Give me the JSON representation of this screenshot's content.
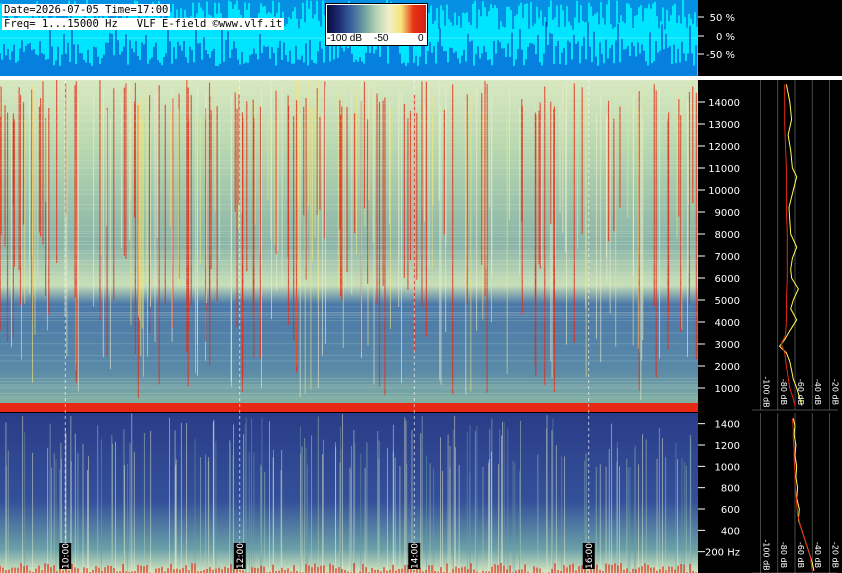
{
  "header": {
    "date_line": "Date=2026-07-05 Time=17:00",
    "freq_line": "Freq= 1...15000 Hz   VLF E-field ©www.vlf.it"
  },
  "colorbar": {
    "labels": [
      "-100 dB",
      "-50",
      "0"
    ],
    "stops": [
      "#0a0a3c",
      "#1e2d78",
      "#3c64a0",
      "#6ea0a0",
      "#b4d2b4",
      "#f0f0c8",
      "#f5e678",
      "#e63214",
      "#d21e14"
    ]
  },
  "colors": {
    "amplitude_bg": "#00e5ff",
    "amplitude_trace": "#0a3cc8",
    "yellow_profile": "#ffff50",
    "red_profile": "#e62814",
    "label": "#ffffff"
  },
  "chart_data": [
    {
      "type": "area",
      "panel": "amplitude",
      "y_ticks": [
        "50 %",
        "0 %",
        "-50 %"
      ],
      "ylim": [
        -100,
        100
      ]
    },
    {
      "type": "heatmap",
      "panel": "spectrogram-high",
      "xlabel": "",
      "ylabel": "",
      "ylim": [
        0,
        15000
      ],
      "y_ticks": [
        "14000",
        "13000",
        "12000",
        "11000",
        "10000",
        "9000",
        "8000",
        "7000",
        "6000",
        "5000",
        "4000",
        "3000",
        "2000",
        "1000"
      ],
      "xlim": [
        "09:00",
        "17:00"
      ],
      "time_marks": [
        "10:00",
        "12:00",
        "14:00",
        "16:00"
      ]
    },
    {
      "type": "heatmap",
      "panel": "spectrogram-low",
      "ylim": [
        0,
        1500
      ],
      "y_ticks": [
        "1400",
        "1200",
        "1000",
        "800",
        "600",
        "400",
        "200 Hz"
      ]
    },
    {
      "type": "line",
      "panel": "spectrum-high",
      "x_ticks": [
        "-100 dB",
        "-80 dB",
        "-60 dB",
        "-40 dB",
        "-20 dB"
      ],
      "xlim": [
        -110,
        -10
      ],
      "series": [
        {
          "color": "#ffff50",
          "points": [
            [
              -70,
              14800
            ],
            [
              -66,
              14000
            ],
            [
              -64,
              13200
            ],
            [
              -68,
              12500
            ],
            [
              -65,
              11800
            ],
            [
              -63,
              11000
            ],
            [
              -58,
              10600
            ],
            [
              -62,
              10000
            ],
            [
              -67,
              9200
            ],
            [
              -66,
              8600
            ],
            [
              -65,
              8000
            ],
            [
              -58,
              7400
            ],
            [
              -63,
              6900
            ],
            [
              -65,
              6400
            ],
            [
              -64,
              6000
            ],
            [
              -56,
              5500
            ],
            [
              -62,
              5000
            ],
            [
              -65,
              4600
            ],
            [
              -58,
              4100
            ],
            [
              -66,
              3600
            ],
            [
              -72,
              3200
            ],
            [
              -78,
              2900
            ],
            [
              -70,
              2600
            ],
            [
              -66,
              2200
            ],
            [
              -64,
              1800
            ],
            [
              -62,
              1400
            ],
            [
              -58,
              1000
            ],
            [
              -55,
              600
            ],
            [
              -52,
              200
            ]
          ]
        },
        {
          "color": "#e62814",
          "points": [
            [
              -72,
              14800
            ],
            [
              -72,
              14000
            ],
            [
              -72,
              13000
            ],
            [
              -71,
              12000
            ],
            [
              -70,
              11000
            ],
            [
              -70,
              10000
            ],
            [
              -70,
              9000
            ],
            [
              -69,
              8000
            ],
            [
              -69,
              7000
            ],
            [
              -69,
              6000
            ],
            [
              -70,
              5000
            ],
            [
              -70,
              4000
            ],
            [
              -71,
              3400
            ],
            [
              -76,
              3000
            ],
            [
              -72,
              2600
            ],
            [
              -70,
              2000
            ],
            [
              -68,
              1500
            ],
            [
              -66,
              1000
            ],
            [
              -62,
              500
            ],
            [
              -60,
              200
            ]
          ]
        }
      ]
    },
    {
      "type": "line",
      "panel": "spectrum-low",
      "x_ticks": [
        "-100 dB",
        "-80 dB",
        "-60 dB",
        "-40 dB",
        "-20 dB"
      ],
      "xlim": [
        -110,
        -10
      ],
      "series": [
        {
          "color": "#ffff50",
          "points": [
            [
              -62,
              1450
            ],
            [
              -60,
              1380
            ],
            [
              -61,
              1300
            ],
            [
              -59,
              1200
            ],
            [
              -60,
              1100
            ],
            [
              -58,
              1000
            ],
            [
              -59,
              900
            ],
            [
              -57,
              800
            ],
            [
              -58,
              700
            ],
            [
              -55,
              600
            ],
            [
              -56,
              500
            ],
            [
              -52,
              400
            ],
            [
              -48,
              300
            ],
            [
              -44,
              200
            ],
            [
              -40,
              100
            ],
            [
              -38,
              20
            ]
          ]
        },
        {
          "color": "#e62814",
          "points": [
            [
              -63,
              1450
            ],
            [
              -62,
              1350
            ],
            [
              -62,
              1250
            ],
            [
              -61,
              1150
            ],
            [
              -61,
              1050
            ],
            [
              -60,
              950
            ],
            [
              -60,
              850
            ],
            [
              -59,
              750
            ],
            [
              -58,
              650
            ],
            [
              -57,
              550
            ],
            [
              -54,
              450
            ],
            [
              -50,
              350
            ],
            [
              -46,
              250
            ],
            [
              -42,
              150
            ],
            [
              -40,
              20
            ]
          ]
        }
      ]
    }
  ]
}
